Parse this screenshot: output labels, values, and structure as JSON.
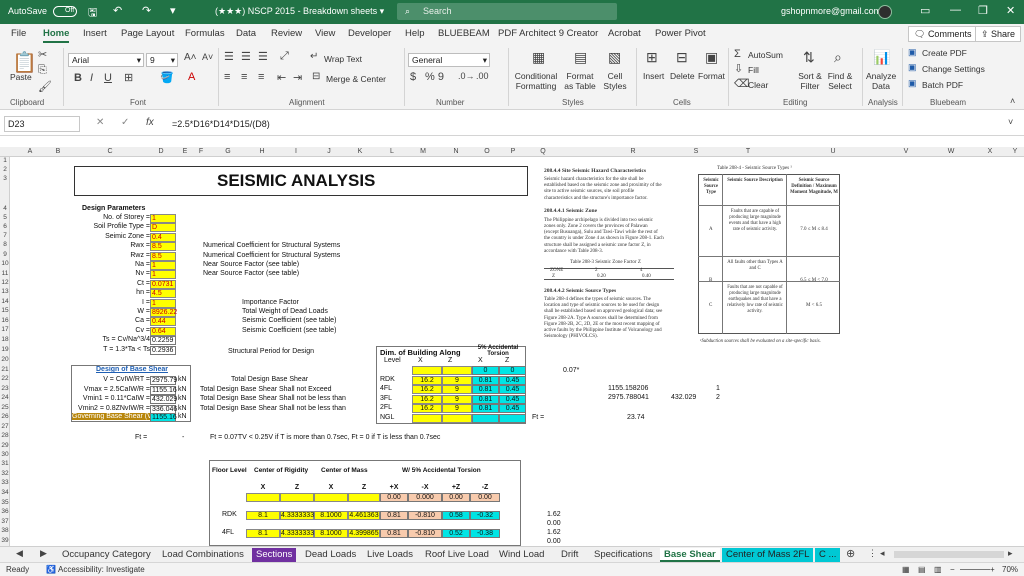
{
  "titlebar": {
    "autosave": "AutoSave",
    "autosave_state": "Off",
    "title": "(★★★) NSCP 2015 - Breakdown sheets ▾",
    "search": "Search",
    "account": "gshopnmore@gmail.com"
  },
  "menu": {
    "items": [
      "File",
      "Home",
      "Insert",
      "Page Layout",
      "Formulas",
      "Data",
      "Review",
      "View",
      "Developer",
      "Help",
      "BLUEBEAM",
      "PDF Architect 9 Creator",
      "Acrobat",
      "Power Pivot"
    ],
    "comments": "Comments",
    "share": "Share"
  },
  "ribbon": {
    "clipboard": {
      "paste": "Paste",
      "label": "Clipboard"
    },
    "font": {
      "name": "Arial",
      "size": "9",
      "label": "Font",
      "b": "B",
      "i": "I",
      "u": "U"
    },
    "alignment": {
      "wrap": "Wrap Text",
      "merge": "Merge & Center",
      "label": "Alignment"
    },
    "number": {
      "format": "General",
      "label": "Number",
      "pct": "% 9"
    },
    "styles": {
      "conditional": "Conditional Formatting",
      "format_table": "Format as Table",
      "cell_styles": "Cell Styles",
      "label": "Styles"
    },
    "cells": {
      "insert": "Insert",
      "delete": "Delete",
      "format": "Format",
      "label": "Cells"
    },
    "editing": {
      "autosum": "AutoSum",
      "fill": "Fill",
      "clear": "Clear",
      "sort": "Sort & Filter",
      "find": "Find & Select",
      "label": "Editing"
    },
    "analysis": {
      "analyze": "Analyze Data",
      "label": "Analysis"
    },
    "bluebeam": {
      "create": "Create PDF",
      "settings": "Change Settings",
      "batch": "Batch PDF",
      "label": "Bluebeam"
    }
  },
  "formula_bar": {
    "cell": "D23",
    "fx": "fx",
    "formula": "=2.5*D16*D14*D15/(D8)"
  },
  "columns": [
    "A",
    "B",
    "C",
    "D",
    "E",
    "F",
    "G",
    "H",
    "I",
    "J",
    "K",
    "L",
    "M",
    "N",
    "O",
    "P",
    "Q",
    "R",
    "S",
    "T",
    "U",
    "V",
    "W",
    "X",
    "Y"
  ],
  "rows": [
    "1",
    "2",
    "3",
    "4",
    "5",
    "6",
    "7",
    "8",
    "9",
    "10",
    "11",
    "12",
    "13",
    "14",
    "15",
    "16",
    "17",
    "18",
    "19",
    "20",
    "21",
    "22",
    "23",
    "24",
    "25",
    "26",
    "27",
    "28",
    "29",
    "30",
    "31",
    "32",
    "33",
    "34",
    "35",
    "36",
    "37",
    "38",
    "39",
    "40"
  ],
  "sheet": {
    "title": "SEISMIC ANALYSIS",
    "design_params": "Design Parameters",
    "params": [
      {
        "label": "No. of Storey =",
        "value": "1",
        "note": ""
      },
      {
        "label": "Soil Profile Type =",
        "value": "D",
        "note": ""
      },
      {
        "label": "Seimic Zone =",
        "value": "0.4",
        "note": ""
      },
      {
        "label": "Rwx =",
        "value": "8.5",
        "note": "Numerical Coefficient for Structural Systems"
      },
      {
        "label": "Rwz =",
        "value": "8.5",
        "note": "Numerical Coefficient for Structural Systems"
      },
      {
        "label": "Na =",
        "value": "1",
        "note": "Near Source Factor (see table)"
      },
      {
        "label": "Nv =",
        "value": "1",
        "note": "Near Source Factor (see table)"
      },
      {
        "label": "Ct =",
        "value": "0.0731",
        "note": ""
      },
      {
        "label": "hn =",
        "value": "4.5",
        "note": ""
      },
      {
        "label": "I =",
        "value": "1",
        "note": "Importance Factor"
      },
      {
        "label": "W =",
        "value": "8926.22",
        "note": "Total Weight of Dead Loads"
      },
      {
        "label": "Ca =",
        "value": "0.44",
        "note": "Seismic Coefficient (see table)"
      },
      {
        "label": "Cv =",
        "value": "0.64",
        "note": "Seismic Coefficient (see table)"
      }
    ],
    "ts_label": "Ts = Cv/Na^3/4",
    "ts_value": "0.2259",
    "t_label": "T = 1.3*Ta < Ts",
    "t_value": "0.2936",
    "t_note": "Structural Period for Design",
    "base_shear_title": "Design of Base Shear",
    "base_shear": [
      {
        "label": "V = CvIW/RT =",
        "value": "2975.79",
        "unit": "kN",
        "note": "Total Design Base Shear"
      },
      {
        "label": "Vmax = 2.5CaIW/R =",
        "value": "1155.16",
        "unit": "kN",
        "note": "Total Design Base Shear Shall not Exceed"
      },
      {
        "label": "Vmin1 = 0.11*CaIW =",
        "value": "432.029",
        "unit": "kN",
        "note": "Total Design Base Shear Shall not be less than"
      },
      {
        "label": "Vmin2 = 0.8ZNvIW/R =",
        "value": "336.046",
        "unit": "kN",
        "note": "Total Design Base Shear Shall not be less than"
      }
    ],
    "governing_label": "Governing Base Shear (V",
    "governing_value": "1155.16",
    "governing_unit": "kN",
    "ft_label": "Ft =",
    "ft_dash": "-",
    "ft_note": "Ft = 0.07TV < 0.25V if T is more than 0.7sec, Ft = 0 if T is less than 0.7sec",
    "dim_title": "Dim. of Building Along",
    "acc_title": "5% Accidental Torsion",
    "dim_header": [
      "Level",
      "X",
      "Z",
      "X",
      "Z"
    ],
    "dim_rows": [
      {
        "level": "",
        "x": "",
        "z": "",
        "ax": "0",
        "az": "0"
      },
      {
        "level": "RDK",
        "x": "16.2",
        "z": "9",
        "ax": "0.81",
        "az": "0.45"
      },
      {
        "level": "4FL",
        "x": "16.2",
        "z": "9",
        "ax": "0.81",
        "az": "0.45"
      },
      {
        "level": "3FL",
        "x": "16.2",
        "z": "9",
        "ax": "0.81",
        "az": "0.45"
      },
      {
        "level": "2FL",
        "x": "16.2",
        "z": "9",
        "ax": "0.81",
        "az": "0.45"
      },
      {
        "level": "NGL",
        "x": "",
        "z": "",
        "ax": "",
        "az": ""
      }
    ],
    "q_value": "0.07*",
    "r_vals": [
      "1155.158206",
      "2975.788041",
      "432.029"
    ],
    "t_vals": [
      "1",
      "2"
    ],
    "ft_eq": "Ft =",
    "ft_eq_val": "23.74",
    "lower": {
      "floor_level": "Floor Level",
      "cor": "Center of Rigidity",
      "com": "Center of Mass",
      "tors": "W/ 5% Accidental Torsion",
      "sub": [
        "X",
        "Z",
        "X",
        "Z",
        "+X",
        "-X",
        "+Z",
        "-Z"
      ],
      "row0": [
        "",
        "",
        "",
        "",
        "0.00",
        "0.000",
        "0.00",
        "0.00"
      ],
      "rows": [
        {
          "level": "RDK",
          "v": [
            "8.1",
            "4.3333333",
            "8.1000",
            "4.461363",
            "0.81",
            "-0.810",
            "0.58",
            "-0.32"
          ],
          "s": "1.62"
        },
        {
          "level": "4FL",
          "v": [
            "8.1",
            "4.3333333",
            "8.1000",
            "4.399865",
            "0.81",
            "-0.810",
            "0.52",
            "-0.38"
          ],
          "s": "1.62"
        }
      ],
      "s_extra": [
        "0.00",
        "0.00"
      ]
    },
    "ref_left": {
      "h1": "208.4.4    Site Seismic Hazard Characteristics",
      "p1": [
        "Seismic hazard characteristics for the site shall be",
        "established based on the seismic zone and proximity of the",
        "site to active seismic sources, site soil profile",
        "characteristics and the structure's importance factor."
      ],
      "h2": "208.4.4.1        Seismic Zone",
      "p2": [
        "The Philippine archipelago is divided into two seismic",
        "zones only. Zone 2 covers the provinces of Palawan",
        "(except Busuanga), Sulu and Tawi-Tawi while the rest of",
        "the country is under Zone 4 as shown in Figure 208-1. Each",
        "structure shall be assigned a seismic zone factor Z, in",
        "accordance with Table 208-3."
      ],
      "t3": "Table 208-3 Seismic Zone Factor Z",
      "zone_h": [
        "ZONE",
        "2",
        "4"
      ],
      "zone_v": [
        "Z",
        "0.20",
        "0.40"
      ],
      "h3": "208.4.4.2   Seismic Source Types",
      "p3": [
        "Table 208-4 defines the types of seismic sources. The",
        "location and type of seismic sources to be used for design",
        "shall be established based on approved geological data; see",
        "Figure 208-2A. Type A sources shall be determined from",
        "Figure 208-2B, 2C, 2D, 2E or the most recent mapping of",
        "active faults by the Philippine Institute of Volcanology and",
        "Seismology (PHIVOLCS)."
      ]
    },
    "ref_right": {
      "t4": "Table 208-4 - Seismic Source Types ¹",
      "h": [
        "Seismic Source Type",
        "Seismic Source Description",
        "Seismic Source Definition / Maximum Moment Magnitude, M"
      ],
      "rows": [
        {
          "type": "A",
          "desc": "Faults that are capable of producing large magnitude events and that have a high rate of seismic activity.",
          "def": "7.0 ≤ M ≤ 8.4"
        },
        {
          "type": "B",
          "desc": "All faults other than Types A and C",
          "def": "6.5 ≤ M < 7.0"
        },
        {
          "type": "C",
          "desc": "Faults that are not capable of producing large magnitude earthquakes and that have a relatively low rate of seismic activity.",
          "def": "M < 6.5"
        }
      ],
      "foot": "¹Subduction sources shall be evaluated on a site-specific basis."
    }
  },
  "tabs": [
    "Occupancy Category",
    "Load Combinations",
    "Sections",
    "Dead Loads",
    "Live Loads",
    "Roof Live Load",
    "Wind Load",
    "Drift",
    "Specifications",
    "Base Shear",
    "Center of Mass 2FL",
    "C ..."
  ],
  "status": {
    "ready": "Ready",
    "accessibility": "Accessibility: Investigate",
    "zoom": "70%"
  }
}
